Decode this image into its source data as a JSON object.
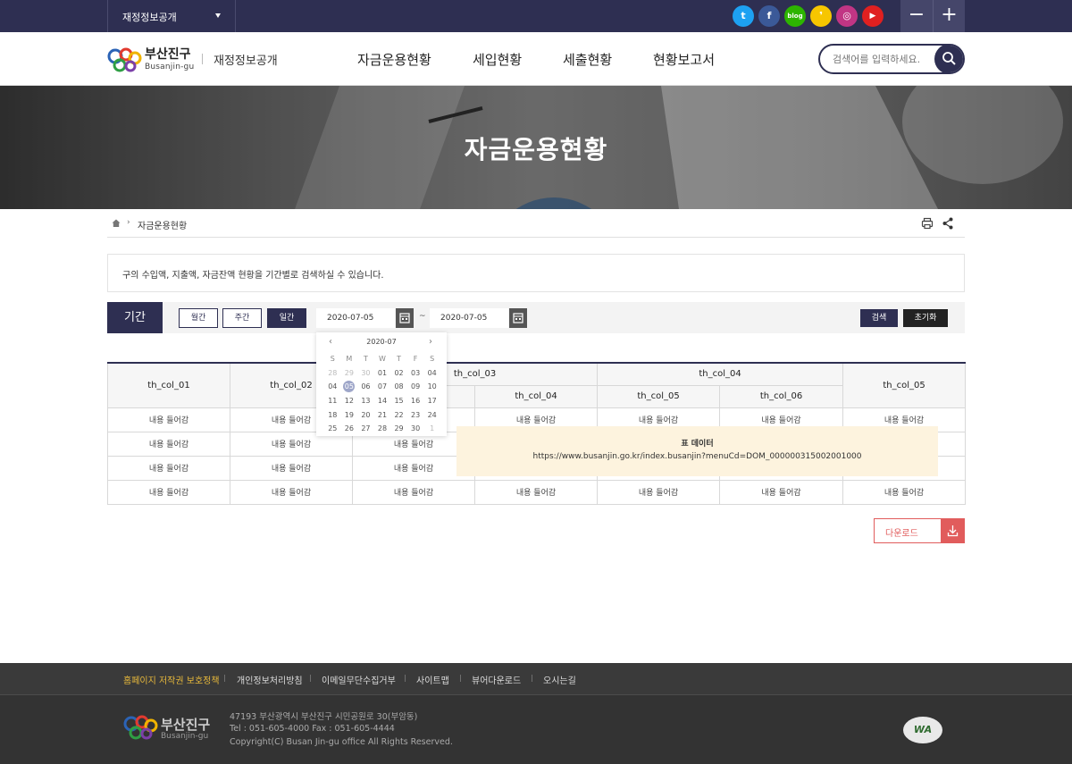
{
  "topbar": {
    "site_select": "재정정보공개",
    "sns": [
      {
        "name": "twitter",
        "glyph": "t",
        "color": "#1da1f2"
      },
      {
        "name": "facebook",
        "glyph": "f",
        "color": "#3b5998"
      },
      {
        "name": "blog",
        "glyph": "blog",
        "color": "#2db400"
      },
      {
        "name": "kakaostory",
        "glyph": "❜",
        "color": "#f7c600"
      },
      {
        "name": "instagram",
        "glyph": "◎",
        "color": "#c13584"
      },
      {
        "name": "youtube",
        "glyph": "▶",
        "color": "#e02020"
      }
    ],
    "zoom_out": "−",
    "zoom_in": "+"
  },
  "header": {
    "logo_name": "부산진구",
    "logo_en": "Busanjin-gu",
    "logo_sub": "재정정보공개",
    "gnb": [
      "자금운용현황",
      "세입현황",
      "세출현황",
      "현황보고서"
    ],
    "search_placeholder": "검색어를 입력하세요."
  },
  "visual": {
    "title": "자금운용현황"
  },
  "breadcrumb": {
    "current": "자금운용현황"
  },
  "info_text": "구의 수입액, 지출액, 자금잔액 현황을 기간별로 검색하실 수 있습니다.",
  "period": {
    "label": "기간",
    "buttons": [
      "월간",
      "주간",
      "일간"
    ],
    "active": "일간",
    "start_date": "2020-07-05",
    "end_date": "2020-07-05",
    "tilde": "~",
    "search_label": "검색",
    "reset_label": "초기화"
  },
  "datepicker": {
    "month": "2020-07",
    "weekdays": [
      "S",
      "M",
      "T",
      "W",
      "T",
      "F",
      "S"
    ],
    "weeks": [
      [
        "28",
        "29",
        "30",
        "01",
        "02",
        "03",
        "04"
      ],
      [
        "04",
        "05",
        "06",
        "07",
        "08",
        "09",
        "10"
      ],
      [
        "11",
        "12",
        "13",
        "14",
        "15",
        "16",
        "17"
      ],
      [
        "18",
        "19",
        "20",
        "21",
        "22",
        "23",
        "24"
      ],
      [
        "25",
        "26",
        "27",
        "28",
        "29",
        "30",
        "1"
      ]
    ],
    "selected": "05"
  },
  "table": {
    "headers_row1": [
      "th_col_01",
      "th_col_02",
      "th_col_03",
      "th_col_04",
      "th_col_05"
    ],
    "headers_row2": [
      "th_col_04",
      "th_col_05",
      "th_col_06"
    ],
    "cell": "내용 들어감",
    "rows": 4
  },
  "tooltip": {
    "title": "표 데이터",
    "url": "https://www.busanjin.go.kr/index.busanjin?menuCd=DOM_000000315002001000"
  },
  "download_label": "다운로드",
  "footer": {
    "links": [
      "홈페이지 저작권 보호정책",
      "개인정보처리방침",
      "이메일무단수집거부",
      "사이트맵",
      "뷰어다운로드",
      "오시는길"
    ],
    "logo_name": "부산진구",
    "logo_en": "Busanjin-gu",
    "address": "47193 부산광역시 부산진구 시민공원로 30(부암동)",
    "tel": "Tel : 051-605-4000  Fax : 051-605-4444",
    "copyright": "Copyright(C) Busan Jin-gu office All Rights Reserved.",
    "wa_mark": "WA"
  }
}
